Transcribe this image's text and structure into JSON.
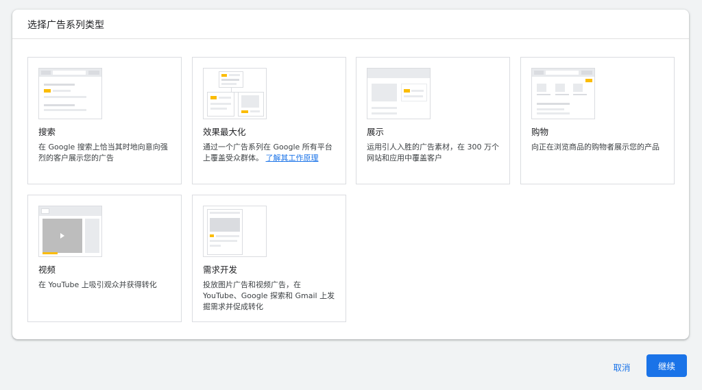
{
  "dialog": {
    "title": "选择广告系列类型"
  },
  "cards": [
    {
      "title": "搜索",
      "desc": "在 Google 搜索上恰当其时地向意向强烈的客户展示您的广告"
    },
    {
      "title": "效果最大化",
      "desc": "通过一个广告系列在 Google 所有平台上覆盖受众群体。",
      "link": "了解其工作原理"
    },
    {
      "title": "展示",
      "desc": "运用引人入胜的广告素材，在 300 万个网站和应用中覆盖客户"
    },
    {
      "title": "购物",
      "desc": "向正在浏览商品的购物者展示您的产品"
    },
    {
      "title": "视频",
      "desc": "在 YouTube 上吸引观众并获得转化"
    },
    {
      "title": "需求开发",
      "desc": "投放图片广告和视频广告，在 YouTube、Google 探索和 Gmail 上发掘需求并促成转化"
    }
  ],
  "footer": {
    "cancel": "取消",
    "continue": "继续"
  },
  "colors": {
    "accent": "#1a73e8",
    "highlight": "#fbbc04"
  }
}
